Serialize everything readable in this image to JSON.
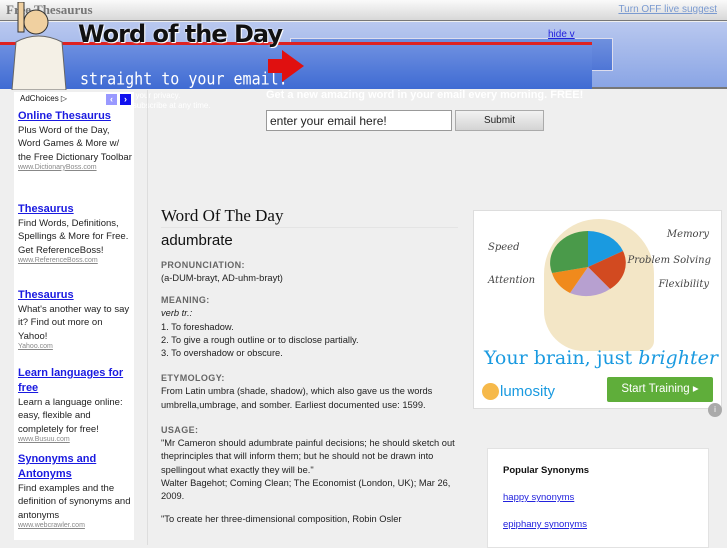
{
  "topbar": {
    "site_title": "Free Thesaurus",
    "live_suggest_link": "Turn OFF live suggest"
  },
  "banner": {
    "title": "Word of the Day",
    "subtitle": "straight to your email.",
    "privacy_1": "We respect your privacy.",
    "privacy_2": "You can unsubscribe at any time.",
    "hide_link": "hide v",
    "cta": "Get a new amazing word in your email every morning. FREE!",
    "email_placeholder": "enter your email here!",
    "submit_label": "Submit"
  },
  "left_ads": {
    "adchoices": "AdChoices",
    "items": [
      {
        "title": "Online Thesaurus",
        "text": "Plus Word of the Day, Word Games & More w/ the Free Dictionary Toolbar",
        "url": "www.DictionaryBoss.com"
      },
      {
        "title": "Thesaurus",
        "text": "Find Words, Definitions, Spellings & More for Free. Get ReferenceBoss!",
        "url": "www.ReferenceBoss.com"
      },
      {
        "title": "Thesaurus",
        "text": "What's another way to say it? Find out more on Yahoo!",
        "url": "Yahoo.com"
      },
      {
        "title": "Learn languages for free",
        "text": "Learn a language online: easy, flexible and completely for free!",
        "url": "www.Busuu.com"
      },
      {
        "title": "Synonyms and Antonyms",
        "text": "Find examples and the definition of synonyms and antonyms",
        "url": "www.webcrawler.com"
      }
    ]
  },
  "main": {
    "heading": "Word Of The Day",
    "word": "adumbrate",
    "pronunciation_label": "PRONUNCIATION:",
    "pronunciation": "(a-DUM-brayt, AD-uhm-brayt)",
    "meaning_label": "MEANING:",
    "pos": "verb tr.:",
    "meanings": [
      "1. To foreshadow.",
      "2. To give a rough outline or to disclose partially.",
      "3. To overshadow or obscure."
    ],
    "etymology_label": "ETYMOLOGY:",
    "etymology": "From Latin umbra (shade, shadow), which also gave us the words umbrella,umbrage, and somber. Earliest documented use: 1599.",
    "usage_label": "USAGE:",
    "usage_quote": "\"Mr Cameron should adumbrate painful decisions; he should sketch out theprinciples that will inform them; but he should not be drawn into spellingout what exactly they will be.\"",
    "usage_source": "Walter Bagehot; Coming Clean; The Economist (London, UK); Mar 26, 2009.",
    "usage_quote2": "\"To create her three-dimensional composition, Robin Osler"
  },
  "right_ad": {
    "labels": [
      "Speed",
      "Attention",
      "Memory",
      "Problem Solving",
      "Flexibility"
    ],
    "headline": "Your brain, just ",
    "headline_em": "brighter",
    "brand": "lumosity",
    "cta": "Start Training ▸"
  },
  "synonyms": {
    "title": "Popular Synonyms",
    "links": [
      "happy synonyms",
      "epiphany synonyms"
    ]
  }
}
